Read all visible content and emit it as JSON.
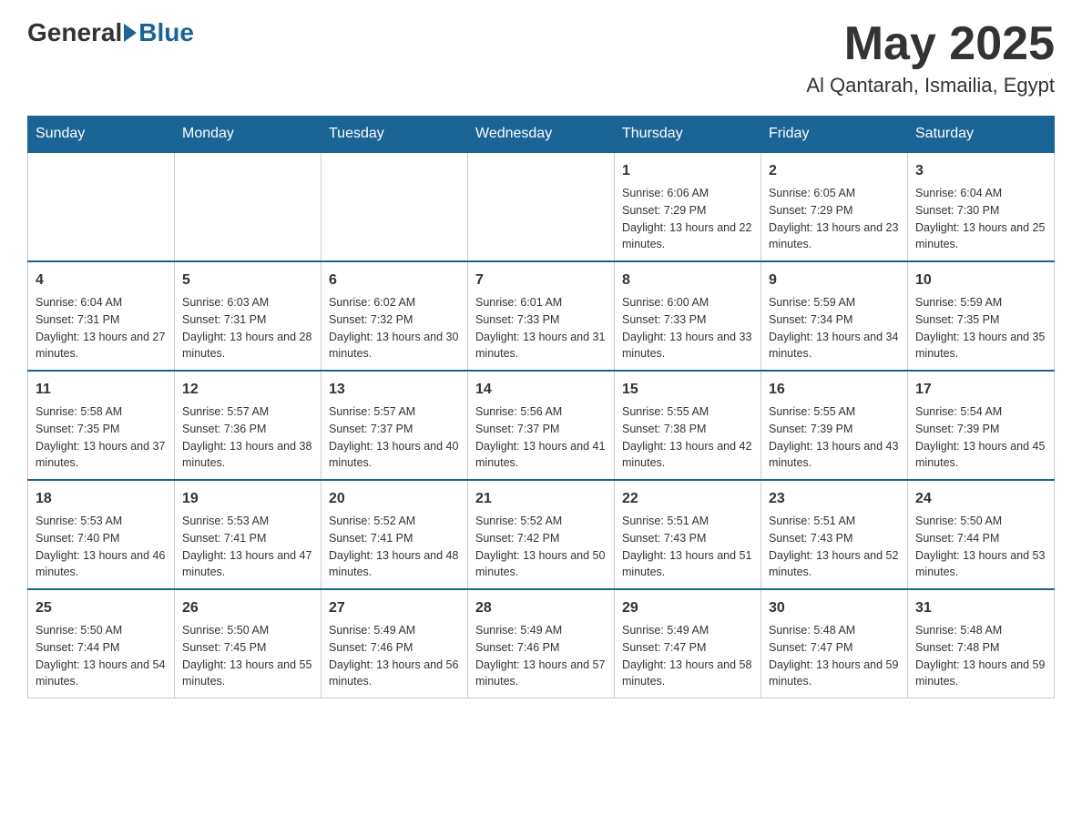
{
  "header": {
    "logo_general": "General",
    "logo_blue": "Blue",
    "month": "May 2025",
    "location": "Al Qantarah, Ismailia, Egypt"
  },
  "weekdays": [
    "Sunday",
    "Monday",
    "Tuesday",
    "Wednesday",
    "Thursday",
    "Friday",
    "Saturday"
  ],
  "weeks": [
    [
      {
        "day": "",
        "info": ""
      },
      {
        "day": "",
        "info": ""
      },
      {
        "day": "",
        "info": ""
      },
      {
        "day": "",
        "info": ""
      },
      {
        "day": "1",
        "info": "Sunrise: 6:06 AM\nSunset: 7:29 PM\nDaylight: 13 hours and 22 minutes."
      },
      {
        "day": "2",
        "info": "Sunrise: 6:05 AM\nSunset: 7:29 PM\nDaylight: 13 hours and 23 minutes."
      },
      {
        "day": "3",
        "info": "Sunrise: 6:04 AM\nSunset: 7:30 PM\nDaylight: 13 hours and 25 minutes."
      }
    ],
    [
      {
        "day": "4",
        "info": "Sunrise: 6:04 AM\nSunset: 7:31 PM\nDaylight: 13 hours and 27 minutes."
      },
      {
        "day": "5",
        "info": "Sunrise: 6:03 AM\nSunset: 7:31 PM\nDaylight: 13 hours and 28 minutes."
      },
      {
        "day": "6",
        "info": "Sunrise: 6:02 AM\nSunset: 7:32 PM\nDaylight: 13 hours and 30 minutes."
      },
      {
        "day": "7",
        "info": "Sunrise: 6:01 AM\nSunset: 7:33 PM\nDaylight: 13 hours and 31 minutes."
      },
      {
        "day": "8",
        "info": "Sunrise: 6:00 AM\nSunset: 7:33 PM\nDaylight: 13 hours and 33 minutes."
      },
      {
        "day": "9",
        "info": "Sunrise: 5:59 AM\nSunset: 7:34 PM\nDaylight: 13 hours and 34 minutes."
      },
      {
        "day": "10",
        "info": "Sunrise: 5:59 AM\nSunset: 7:35 PM\nDaylight: 13 hours and 35 minutes."
      }
    ],
    [
      {
        "day": "11",
        "info": "Sunrise: 5:58 AM\nSunset: 7:35 PM\nDaylight: 13 hours and 37 minutes."
      },
      {
        "day": "12",
        "info": "Sunrise: 5:57 AM\nSunset: 7:36 PM\nDaylight: 13 hours and 38 minutes."
      },
      {
        "day": "13",
        "info": "Sunrise: 5:57 AM\nSunset: 7:37 PM\nDaylight: 13 hours and 40 minutes."
      },
      {
        "day": "14",
        "info": "Sunrise: 5:56 AM\nSunset: 7:37 PM\nDaylight: 13 hours and 41 minutes."
      },
      {
        "day": "15",
        "info": "Sunrise: 5:55 AM\nSunset: 7:38 PM\nDaylight: 13 hours and 42 minutes."
      },
      {
        "day": "16",
        "info": "Sunrise: 5:55 AM\nSunset: 7:39 PM\nDaylight: 13 hours and 43 minutes."
      },
      {
        "day": "17",
        "info": "Sunrise: 5:54 AM\nSunset: 7:39 PM\nDaylight: 13 hours and 45 minutes."
      }
    ],
    [
      {
        "day": "18",
        "info": "Sunrise: 5:53 AM\nSunset: 7:40 PM\nDaylight: 13 hours and 46 minutes."
      },
      {
        "day": "19",
        "info": "Sunrise: 5:53 AM\nSunset: 7:41 PM\nDaylight: 13 hours and 47 minutes."
      },
      {
        "day": "20",
        "info": "Sunrise: 5:52 AM\nSunset: 7:41 PM\nDaylight: 13 hours and 48 minutes."
      },
      {
        "day": "21",
        "info": "Sunrise: 5:52 AM\nSunset: 7:42 PM\nDaylight: 13 hours and 50 minutes."
      },
      {
        "day": "22",
        "info": "Sunrise: 5:51 AM\nSunset: 7:43 PM\nDaylight: 13 hours and 51 minutes."
      },
      {
        "day": "23",
        "info": "Sunrise: 5:51 AM\nSunset: 7:43 PM\nDaylight: 13 hours and 52 minutes."
      },
      {
        "day": "24",
        "info": "Sunrise: 5:50 AM\nSunset: 7:44 PM\nDaylight: 13 hours and 53 minutes."
      }
    ],
    [
      {
        "day": "25",
        "info": "Sunrise: 5:50 AM\nSunset: 7:44 PM\nDaylight: 13 hours and 54 minutes."
      },
      {
        "day": "26",
        "info": "Sunrise: 5:50 AM\nSunset: 7:45 PM\nDaylight: 13 hours and 55 minutes."
      },
      {
        "day": "27",
        "info": "Sunrise: 5:49 AM\nSunset: 7:46 PM\nDaylight: 13 hours and 56 minutes."
      },
      {
        "day": "28",
        "info": "Sunrise: 5:49 AM\nSunset: 7:46 PM\nDaylight: 13 hours and 57 minutes."
      },
      {
        "day": "29",
        "info": "Sunrise: 5:49 AM\nSunset: 7:47 PM\nDaylight: 13 hours and 58 minutes."
      },
      {
        "day": "30",
        "info": "Sunrise: 5:48 AM\nSunset: 7:47 PM\nDaylight: 13 hours and 59 minutes."
      },
      {
        "day": "31",
        "info": "Sunrise: 5:48 AM\nSunset: 7:48 PM\nDaylight: 13 hours and 59 minutes."
      }
    ]
  ]
}
